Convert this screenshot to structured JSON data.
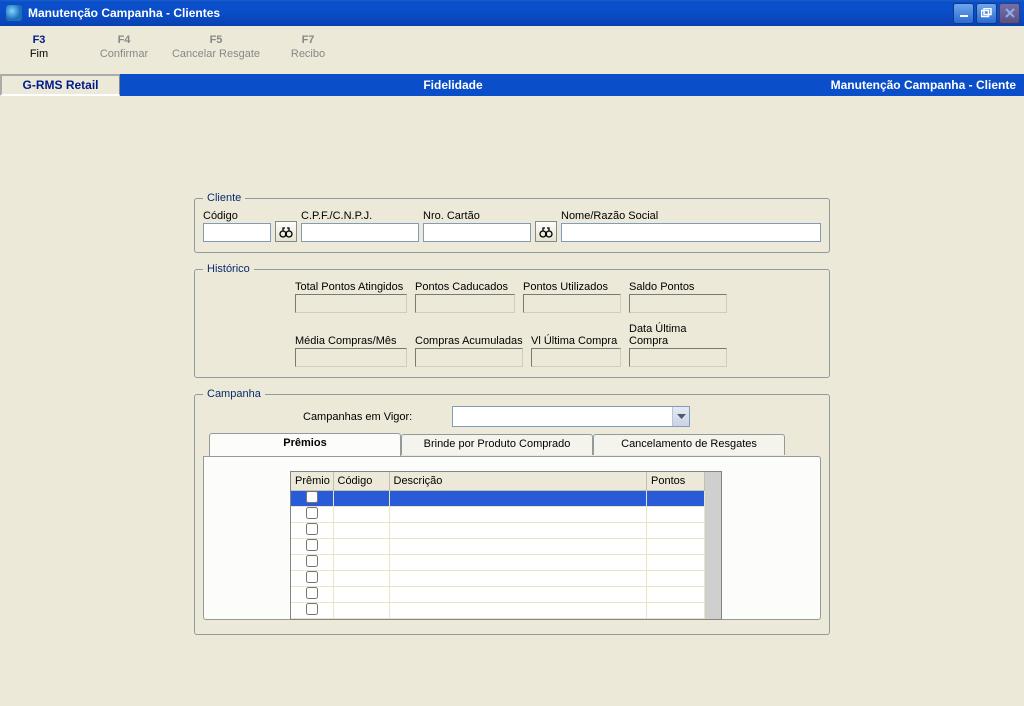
{
  "window": {
    "title": "Manutenção Campanha - Clientes"
  },
  "fn_keys": [
    {
      "key": "F3",
      "label": "Fim",
      "enabled": true
    },
    {
      "key": "F4",
      "label": "Confirmar",
      "enabled": false
    },
    {
      "key": "F5",
      "label": "Cancelar Resgate",
      "enabled": false
    },
    {
      "key": "F7",
      "label": "Recibo",
      "enabled": false
    }
  ],
  "band": {
    "left": "G-RMS Retail",
    "center": "Fidelidade",
    "right": "Manutenção Campanha - Cliente"
  },
  "cliente": {
    "legend": "Cliente",
    "codigo_label": "Código",
    "cpf_label": "C.P.F./C.N.P.J.",
    "nro_cartao_label": "Nro. Cartão",
    "nome_label": "Nome/Razão Social",
    "codigo": "",
    "cpf": "",
    "nro_cartao": "",
    "nome": ""
  },
  "historico": {
    "legend": "Histórico",
    "total_pontos_label": "Total Pontos Atingidos",
    "pontos_caducados_label": "Pontos Caducados",
    "pontos_utilizados_label": "Pontos Utilizados",
    "saldo_pontos_label": "Saldo Pontos",
    "media_compras_label": "Média Compras/Mês",
    "compras_acumuladas_label": "Compras Acumuladas",
    "vl_ultima_label": "Vl Última Compra",
    "data_ultima_label": "Data Última Compra"
  },
  "campanha": {
    "legend": "Campanha",
    "campanhas_label": "Campanhas em Vigor:",
    "selected": "",
    "tabs": {
      "premios": "Prêmios",
      "brinde": "Brinde por Produto Comprado",
      "cancelamento": "Cancelamento de Resgates"
    },
    "grid": {
      "premio": "Prêmio",
      "codigo": "Código",
      "descricao": "Descrição",
      "pontos": "Pontos"
    }
  }
}
